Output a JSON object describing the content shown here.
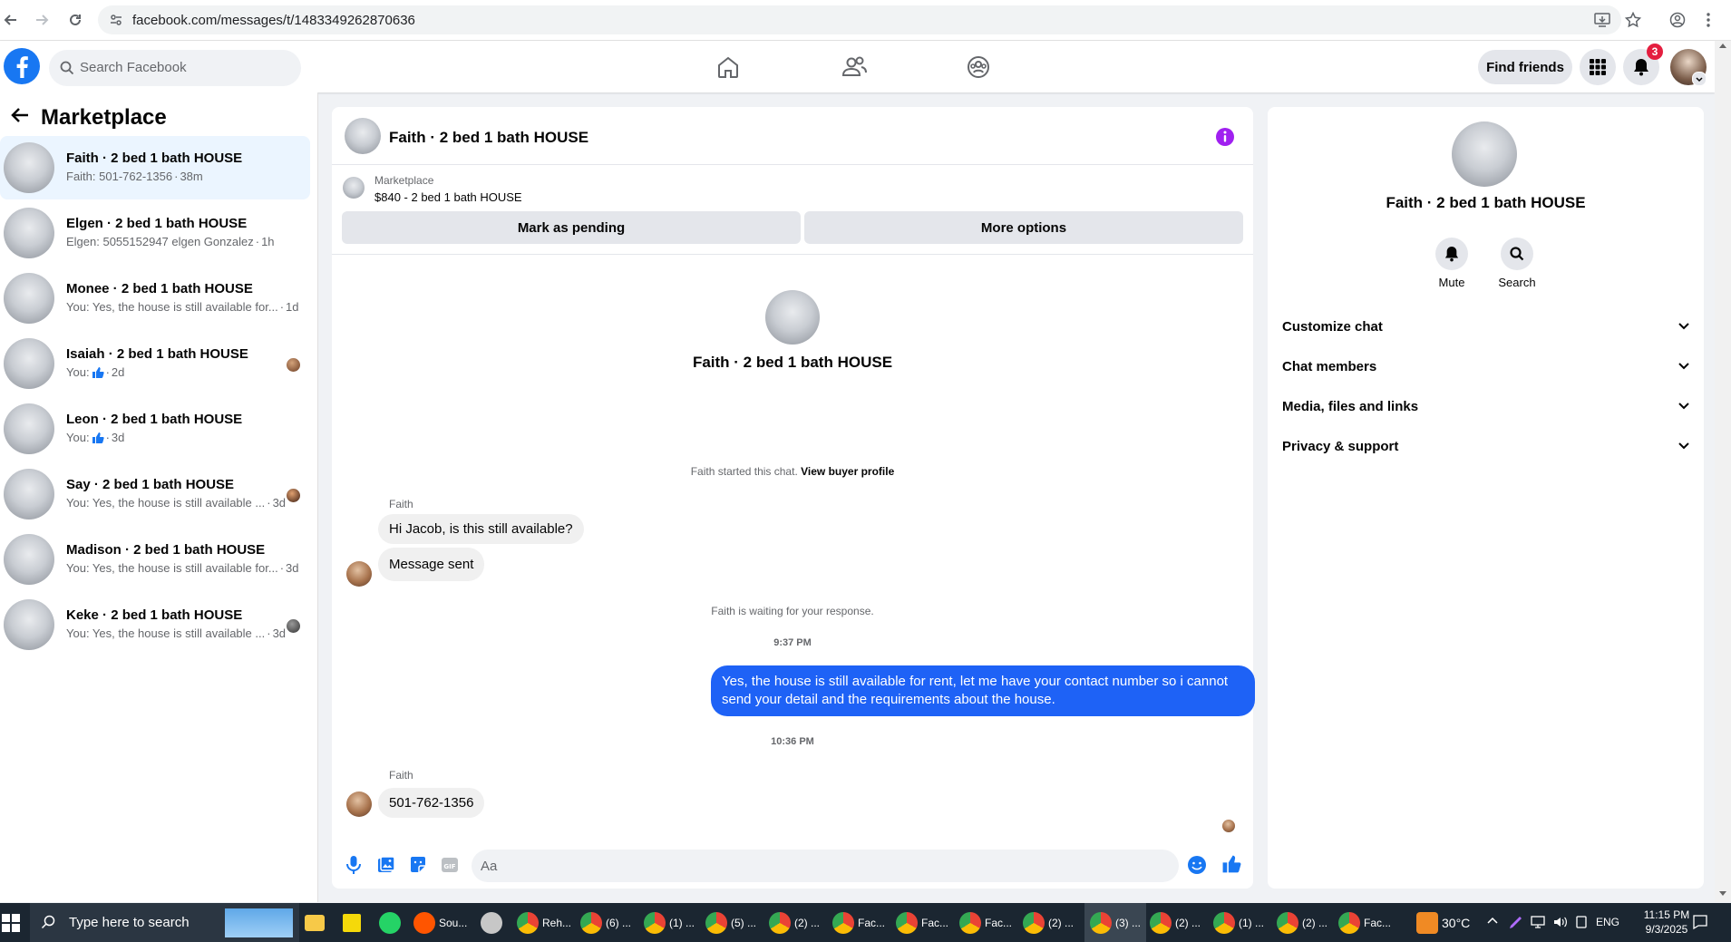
{
  "browser": {
    "url": "facebook.com/messages/t/1483349262870636"
  },
  "header": {
    "search_placeholder": "Search Facebook",
    "find_friends": "Find friends",
    "notification_count": "3"
  },
  "left": {
    "title": "Marketplace",
    "conversations": [
      {
        "name": "Faith · 2 bed 1 bath HOUSE",
        "preview": "Faith: 501-762-1356",
        "time": "38m",
        "active": true
      },
      {
        "name": "Elgen · 2 bed 1 bath HOUSE",
        "preview": "Elgen: 5055152947 elgen Gonzalez",
        "time": "1h"
      },
      {
        "name": "Monee · 2 bed 1 bath HOUSE",
        "preview": "You: Yes, the house is still available for...",
        "time": "1d"
      },
      {
        "name": "Isaiah · 2 bed 1 bath HOUSE",
        "preview": "You:",
        "time": "2d"
      },
      {
        "name": "Leon · 2 bed 1 bath HOUSE",
        "preview": "You:",
        "time": "3d"
      },
      {
        "name": "Say · 2 bed 1 bath HOUSE",
        "preview": "You: Yes, the house is still available ...",
        "time": "3d"
      },
      {
        "name": "Madison · 2 bed 1 bath HOUSE",
        "preview": "You: Yes, the house is still available for...",
        "time": "3d"
      },
      {
        "name": "Keke · 2 bed 1 bath HOUSE",
        "preview": "You: Yes, the house is still available ...",
        "time": "3d"
      }
    ]
  },
  "chat": {
    "title": "Faith · 2 bed 1 bath HOUSE",
    "listing_source": "Marketplace",
    "listing": "$840 - 2 bed 1 bath HOUSE",
    "mark_pending": "Mark as pending",
    "more_options": "More options",
    "profile_name": "Faith · 2 bed 1 bath HOUSE",
    "started": "Faith started this chat.",
    "view_buyer": "View buyer profile",
    "sender1": "Faith",
    "msg1": "Hi Jacob, is this still available?",
    "msg2": "Message sent",
    "waiting": "Faith is waiting for your response.",
    "time1": "9:37 PM",
    "my_msg": "Yes, the house is still available for rent, let me have your contact number so i cannot send your detail and the requirements about the house.",
    "time2": "10:36 PM",
    "sender2": "Faith",
    "msg3": "501-762-1356",
    "composer_placeholder": "Aa"
  },
  "info": {
    "name": "Faith · 2 bed 1 bath HOUSE",
    "mute": "Mute",
    "search": "Search",
    "sections": [
      "Customize chat",
      "Chat members",
      "Media, files and links",
      "Privacy & support"
    ]
  },
  "taskbar": {
    "search_placeholder": "Type here to search",
    "apps": [
      "Sou...",
      "Reh...",
      "(6) ...",
      "(1) ...",
      "(5) ...",
      "(2) ...",
      "Fac...",
      "Fac...",
      "Fac...",
      "(2) ...",
      "(3) ...",
      "(2) ...",
      "(1) ...",
      "(2) ...",
      "Fac..."
    ],
    "temperature": "30°C",
    "language": "ENG",
    "time": "11:15 PM",
    "date": "9/3/2025"
  },
  "colors": {
    "brand": "#1877f2",
    "my_bubble": "#1e62f6",
    "info_icon": "#a020f0",
    "taskbar": "#1b2631"
  }
}
